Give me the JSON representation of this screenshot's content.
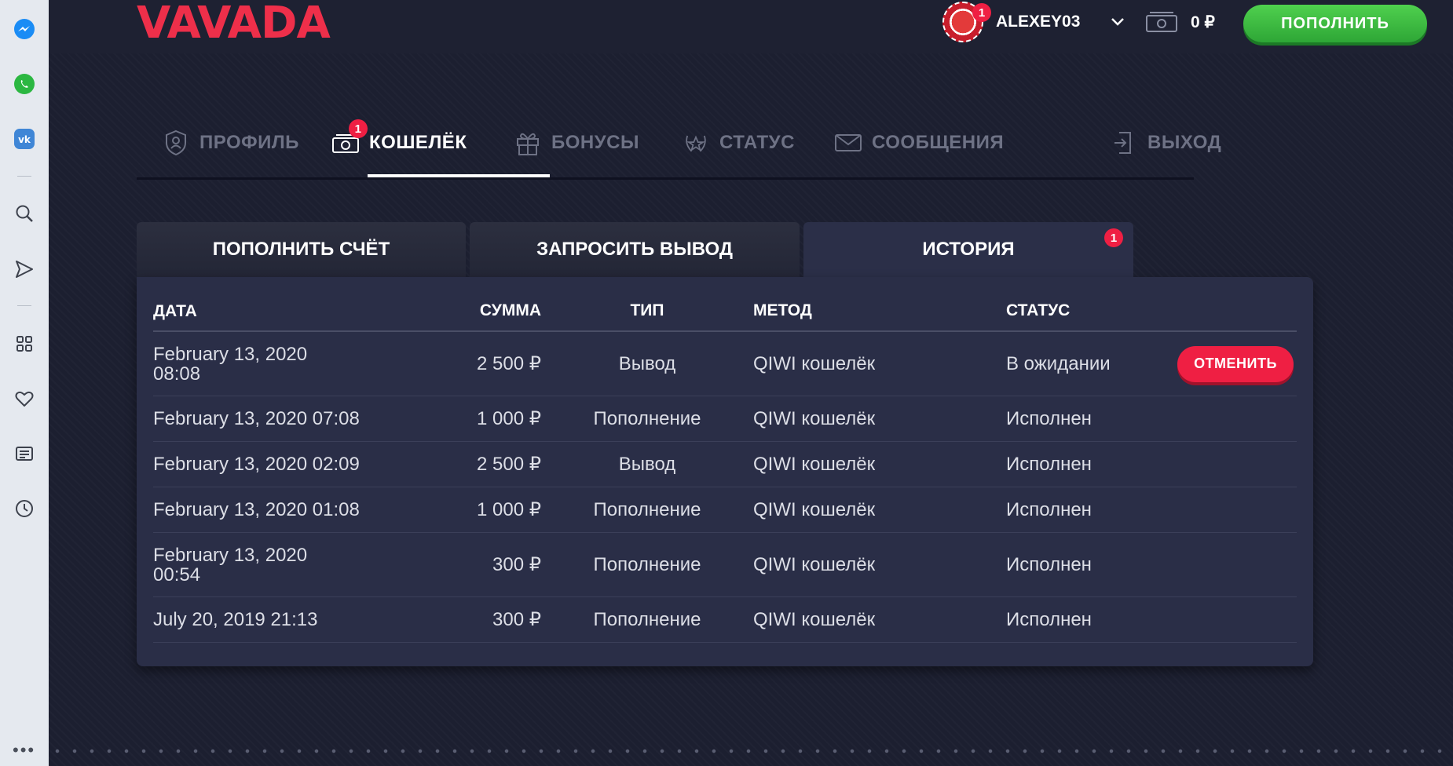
{
  "header": {
    "logo": "VAVADA",
    "username": "ALEXEY03",
    "avatar_badge": "1",
    "balance": "0 ₽",
    "deposit_button": "ПОПОЛНИТЬ"
  },
  "nav": {
    "items": [
      {
        "label": "ПРОФИЛЬ",
        "icon": "shield-icon"
      },
      {
        "label": "КОШЕЛЁК",
        "icon": "wallet-icon",
        "badge": "1",
        "active": true
      },
      {
        "label": "БОНУСЫ",
        "icon": "gift-icon"
      },
      {
        "label": "СТАТУС",
        "icon": "laurel-icon"
      },
      {
        "label": "СООБЩЕНИЯ",
        "icon": "envelope-icon"
      },
      {
        "label": "ВЫХОД",
        "icon": "logout-icon"
      }
    ]
  },
  "subtabs": [
    {
      "label": "ПОПОЛНИТЬ СЧЁТ"
    },
    {
      "label": "ЗАПРОСИТЬ ВЫВОД"
    },
    {
      "label": "ИСТОРИЯ",
      "badge": "1",
      "active": true
    }
  ],
  "table": {
    "columns": [
      "ДАТА",
      "СУММА",
      "ТИП",
      "МЕТОД",
      "СТАТУС"
    ],
    "rows": [
      {
        "date_line1": "February 13, 2020",
        "date_line2": "08:08",
        "amount": "2 500 ₽",
        "type": "Вывод",
        "method": "QIWI кошелёк",
        "status": "В ожидании",
        "action": "ОТМЕНИТЬ"
      },
      {
        "date_line1": "February 13, 2020 07:08",
        "amount": "1 000 ₽",
        "type": "Пополнение",
        "method": "QIWI кошелёк",
        "status": "Исполнен"
      },
      {
        "date_line1": "February 13, 2020 02:09",
        "amount": "2 500 ₽",
        "type": "Вывод",
        "method": "QIWI кошелёк",
        "status": "Исполнен"
      },
      {
        "date_line1": "February 13, 2020 01:08",
        "amount": "1 000 ₽",
        "type": "Пополнение",
        "method": "QIWI кошелёк",
        "status": "Исполнен"
      },
      {
        "date_line1": "February 13, 2020",
        "date_line2": "00:54",
        "amount": "300 ₽",
        "type": "Пополнение",
        "method": "QIWI кошелёк",
        "status": "Исполнен"
      },
      {
        "date_line1": "July 20, 2019 21:13",
        "amount": "300 ₽",
        "type": "Пополнение",
        "method": "QIWI кошелёк",
        "status": "Исполнен"
      }
    ]
  },
  "sidebar": {
    "icons": [
      "messenger-icon",
      "whatsapp-icon",
      "vk-icon",
      "search-icon",
      "send-icon",
      "apps-icon",
      "heart-icon",
      "news-icon",
      "history-icon",
      "more-icon"
    ]
  },
  "colors": {
    "brand": "#ee2f4a",
    "deposit": "#3cbf3f",
    "cancel": "#ef1f43",
    "panel": "#2a2e47"
  }
}
